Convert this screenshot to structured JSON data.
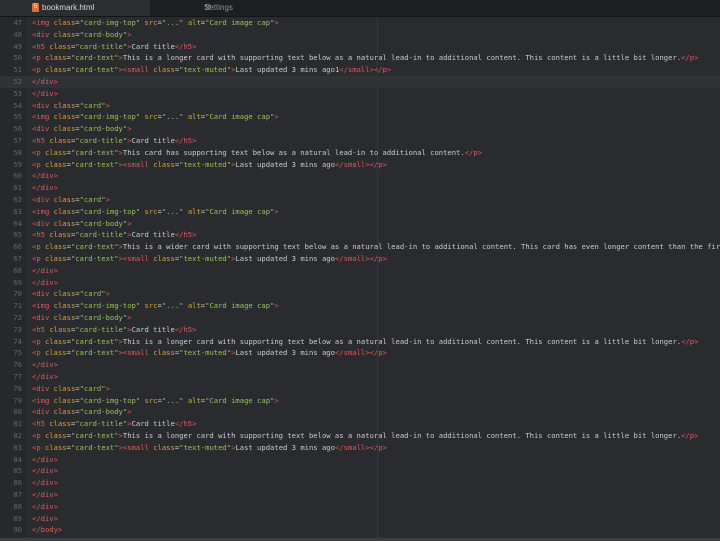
{
  "tabs": {
    "active": {
      "label": "bookmark.html",
      "icon": "html5-icon"
    },
    "inactive": {
      "label": "Settings",
      "icon": "wrench-icon"
    }
  },
  "colors": {
    "tag": "#e05a5a",
    "attr": "#d8a33c",
    "string": "#98c25c",
    "text": "#c9ccd1",
    "background": "#292b2e"
  },
  "lines": [
    {
      "n": "47",
      "text": "<img class=\"card-img-top\" src=\"...\" alt=\"Card image cap\">"
    },
    {
      "n": "48",
      "text": "<div class=\"card-body\">"
    },
    {
      "n": "49",
      "text": "<h5 class=\"card-title\">Card title</h5>"
    },
    {
      "n": "50",
      "text": "<p class=\"card-text\">This is a longer card with supporting text below as a natural lead-in to additional content. This content is a little bit longer.</p>"
    },
    {
      "n": "51",
      "text": "<p class=\"card-text\"><small class=\"text-muted\">Last updated 3 mins ago1</small></p>"
    },
    {
      "n": "52",
      "text": "</div>"
    },
    {
      "n": "53",
      "text": "</div>"
    },
    {
      "n": "54",
      "text": "<div class=\"card\">"
    },
    {
      "n": "55",
      "text": "<img class=\"card-img-top\" src=\"...\" alt=\"Card image cap\">"
    },
    {
      "n": "56",
      "text": "<div class=\"card-body\">"
    },
    {
      "n": "57",
      "text": "<h5 class=\"card-title\">Card title</h5>"
    },
    {
      "n": "58",
      "text": "<p class=\"card-text\">This card has supporting text below as a natural lead-in to additional content.</p>"
    },
    {
      "n": "59",
      "text": "<p class=\"card-text\"><small class=\"text-muted\">Last updated 3 mins ago</small></p>"
    },
    {
      "n": "60",
      "text": "</div>"
    },
    {
      "n": "61",
      "text": "</div>"
    },
    {
      "n": "62",
      "text": "<div class=\"card\">"
    },
    {
      "n": "63",
      "text": "<img class=\"card-img-top\" src=\"...\" alt=\"Card image cap\">"
    },
    {
      "n": "64",
      "text": "<div class=\"card-body\">"
    },
    {
      "n": "65",
      "text": "<h5 class=\"card-title\">Card title</h5>"
    },
    {
      "n": "66",
      "text": "<p class=\"card-text\">This is a wider card with supporting text below as a natural lead-in to additional content. This card has even longer content than the fir"
    },
    {
      "n": "67",
      "text": "<p class=\"card-text\"><small class=\"text-muted\">Last updated 3 mins ago</small></p>"
    },
    {
      "n": "68",
      "text": "</div>"
    },
    {
      "n": "69",
      "text": "</div>"
    },
    {
      "n": "70",
      "text": "<div class=\"card\">"
    },
    {
      "n": "71",
      "text": "<img class=\"card-img-top\" src=\"...\" alt=\"Card image cap\">"
    },
    {
      "n": "72",
      "text": "<div class=\"card-body\">"
    },
    {
      "n": "73",
      "text": "<h5 class=\"card-title\">Card title</h5>"
    },
    {
      "n": "74",
      "text": "<p class=\"card-text\">This is a longer card with supporting text below as a natural lead-in to additional content. This content is a little bit longer.</p>"
    },
    {
      "n": "75",
      "text": "<p class=\"card-text\"><small class=\"text-muted\">Last updated 3 mins ago</small></p>"
    },
    {
      "n": "76",
      "text": "</div>"
    },
    {
      "n": "77",
      "text": "</div>"
    },
    {
      "n": "78",
      "text": "<div class=\"card\">"
    },
    {
      "n": "79",
      "text": "<img class=\"card-img-top\" src=\"...\" alt=\"Card image cap\">"
    },
    {
      "n": "80",
      "text": "<div class=\"card-body\">"
    },
    {
      "n": "81",
      "text": "<h5 class=\"card-title\">Card title</h5>"
    },
    {
      "n": "82",
      "text": "<p class=\"card-text\">This is a longer card with supporting text below as a natural lead-in to additional content. This content is a little bit longer.</p>"
    },
    {
      "n": "83",
      "text": "<p class=\"card-text\"><small class=\"text-muted\">Last updated 3 mins ago</small></p>"
    },
    {
      "n": "84",
      "text": "</div>"
    },
    {
      "n": "85",
      "text": "</div>"
    },
    {
      "n": "86",
      "text": "</div>"
    },
    {
      "n": "87",
      "text": "</div>"
    },
    {
      "n": "88",
      "text": "</div>"
    },
    {
      "n": "89",
      "text": "</div>"
    },
    {
      "n": "90",
      "text": "</body>"
    }
  ],
  "current_line": "52"
}
